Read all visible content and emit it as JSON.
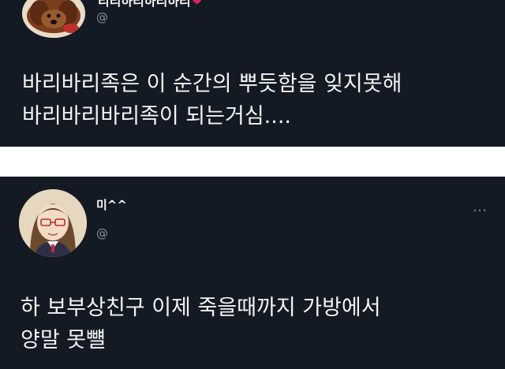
{
  "tweets": [
    {
      "display_name": "리리하리하리하리",
      "handle": "@",
      "text_lines": [
        "바리바리족은 이 순간의 뿌듯함을 잊지못해",
        "바리바리바리족이 되는거심...."
      ]
    },
    {
      "display_name": "미^^",
      "handle": "@",
      "more_label": "…",
      "text_lines": [
        "하  보부상친구 이제 죽을때까지 가방에서",
        "양말 못뺼"
      ]
    }
  ],
  "icons": {
    "heart": "heart-icon",
    "more": "more-options-icon"
  },
  "colors": {
    "tweet_bg": "#141a24",
    "separator": "#ffffff",
    "text": "#f2f3f5",
    "muted": "#8a919b",
    "heart": "#e0245e"
  }
}
